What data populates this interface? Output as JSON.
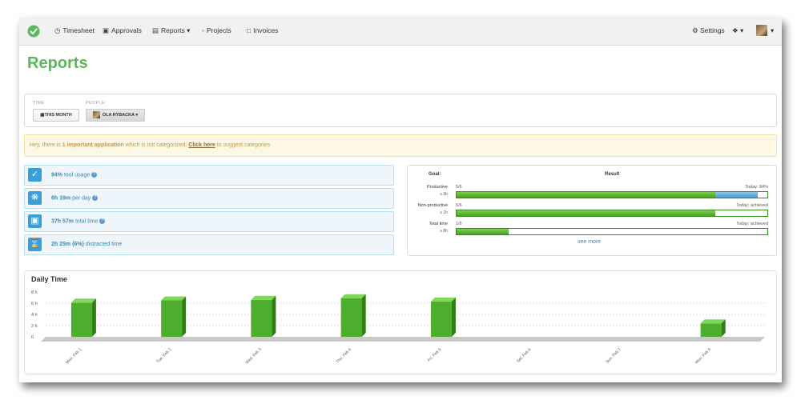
{
  "nav": {
    "items": [
      {
        "label": "Timesheet",
        "icon": "clock-icon"
      },
      {
        "label": "Approvals",
        "icon": "inbox-icon"
      },
      {
        "label": "Reports",
        "icon": "bar-chart-icon"
      },
      {
        "label": "Projects",
        "icon": "folder-icon"
      },
      {
        "label": "Invoices",
        "icon": "document-icon"
      }
    ],
    "settings_label": "Settings",
    "colors": {
      "brand": "#5cb85c"
    }
  },
  "page": {
    "title": "Reports"
  },
  "filters": {
    "time_label": "TIME:",
    "time_value": "THIS MONTH",
    "people_label": "PEOPLE:",
    "people_value": "OLA RYBACKA"
  },
  "alert": {
    "prefix": "Hey, there is ",
    "bold": "1 important application",
    "middle": " which is not categorized. ",
    "link": "Click here",
    "suffix": " to suggest categories"
  },
  "stats": [
    {
      "value": "94%",
      "label": " tool usage",
      "icon": "checkmark-icon"
    },
    {
      "value": "6h 19m",
      "label": " per day",
      "icon": "sun-icon"
    },
    {
      "value": "37h 57m",
      "label": " total time",
      "icon": "monitor-icon"
    },
    {
      "value": "2h 25m (6%)",
      "label": " distracted time",
      "icon": "hourglass-icon"
    }
  ],
  "goals": {
    "goal_header": "Goal:",
    "result_header": "Result",
    "rows": [
      {
        "name": "Productive",
        "target": "≥ 3h",
        "fraction": "5/6",
        "today": "Today: 84%",
        "progress": 0.833,
        "today_progress": 0.84
      },
      {
        "name": "Non-productive",
        "target": "≤ 1h",
        "fraction": "5/6",
        "today": "Today: achieved",
        "progress": 0.833
      },
      {
        "name": "Total time",
        "target": "≥ 8h",
        "fraction": "1/6",
        "today": "Today: achieved",
        "progress": 0.167
      }
    ],
    "see_more": "see more"
  },
  "chart_data": {
    "type": "bar",
    "title": "Daily Time",
    "categories": [
      "Mon, Feb 1",
      "Tue, Feb 2",
      "Wed, Feb 3",
      "Thu, Feb 4",
      "Fri, Feb 5",
      "Sat, Feb 6",
      "Sun, Feb 7",
      "Mon, Feb 8"
    ],
    "values": [
      6.1,
      6.5,
      6.6,
      6.9,
      6.3,
      0,
      0,
      2.4
    ],
    "yticks": [
      "8 h",
      "6 h",
      "4 h",
      "2 h",
      "0"
    ],
    "ylim": [
      0,
      8
    ],
    "grid": true,
    "bar_color": "#4cae2c"
  }
}
